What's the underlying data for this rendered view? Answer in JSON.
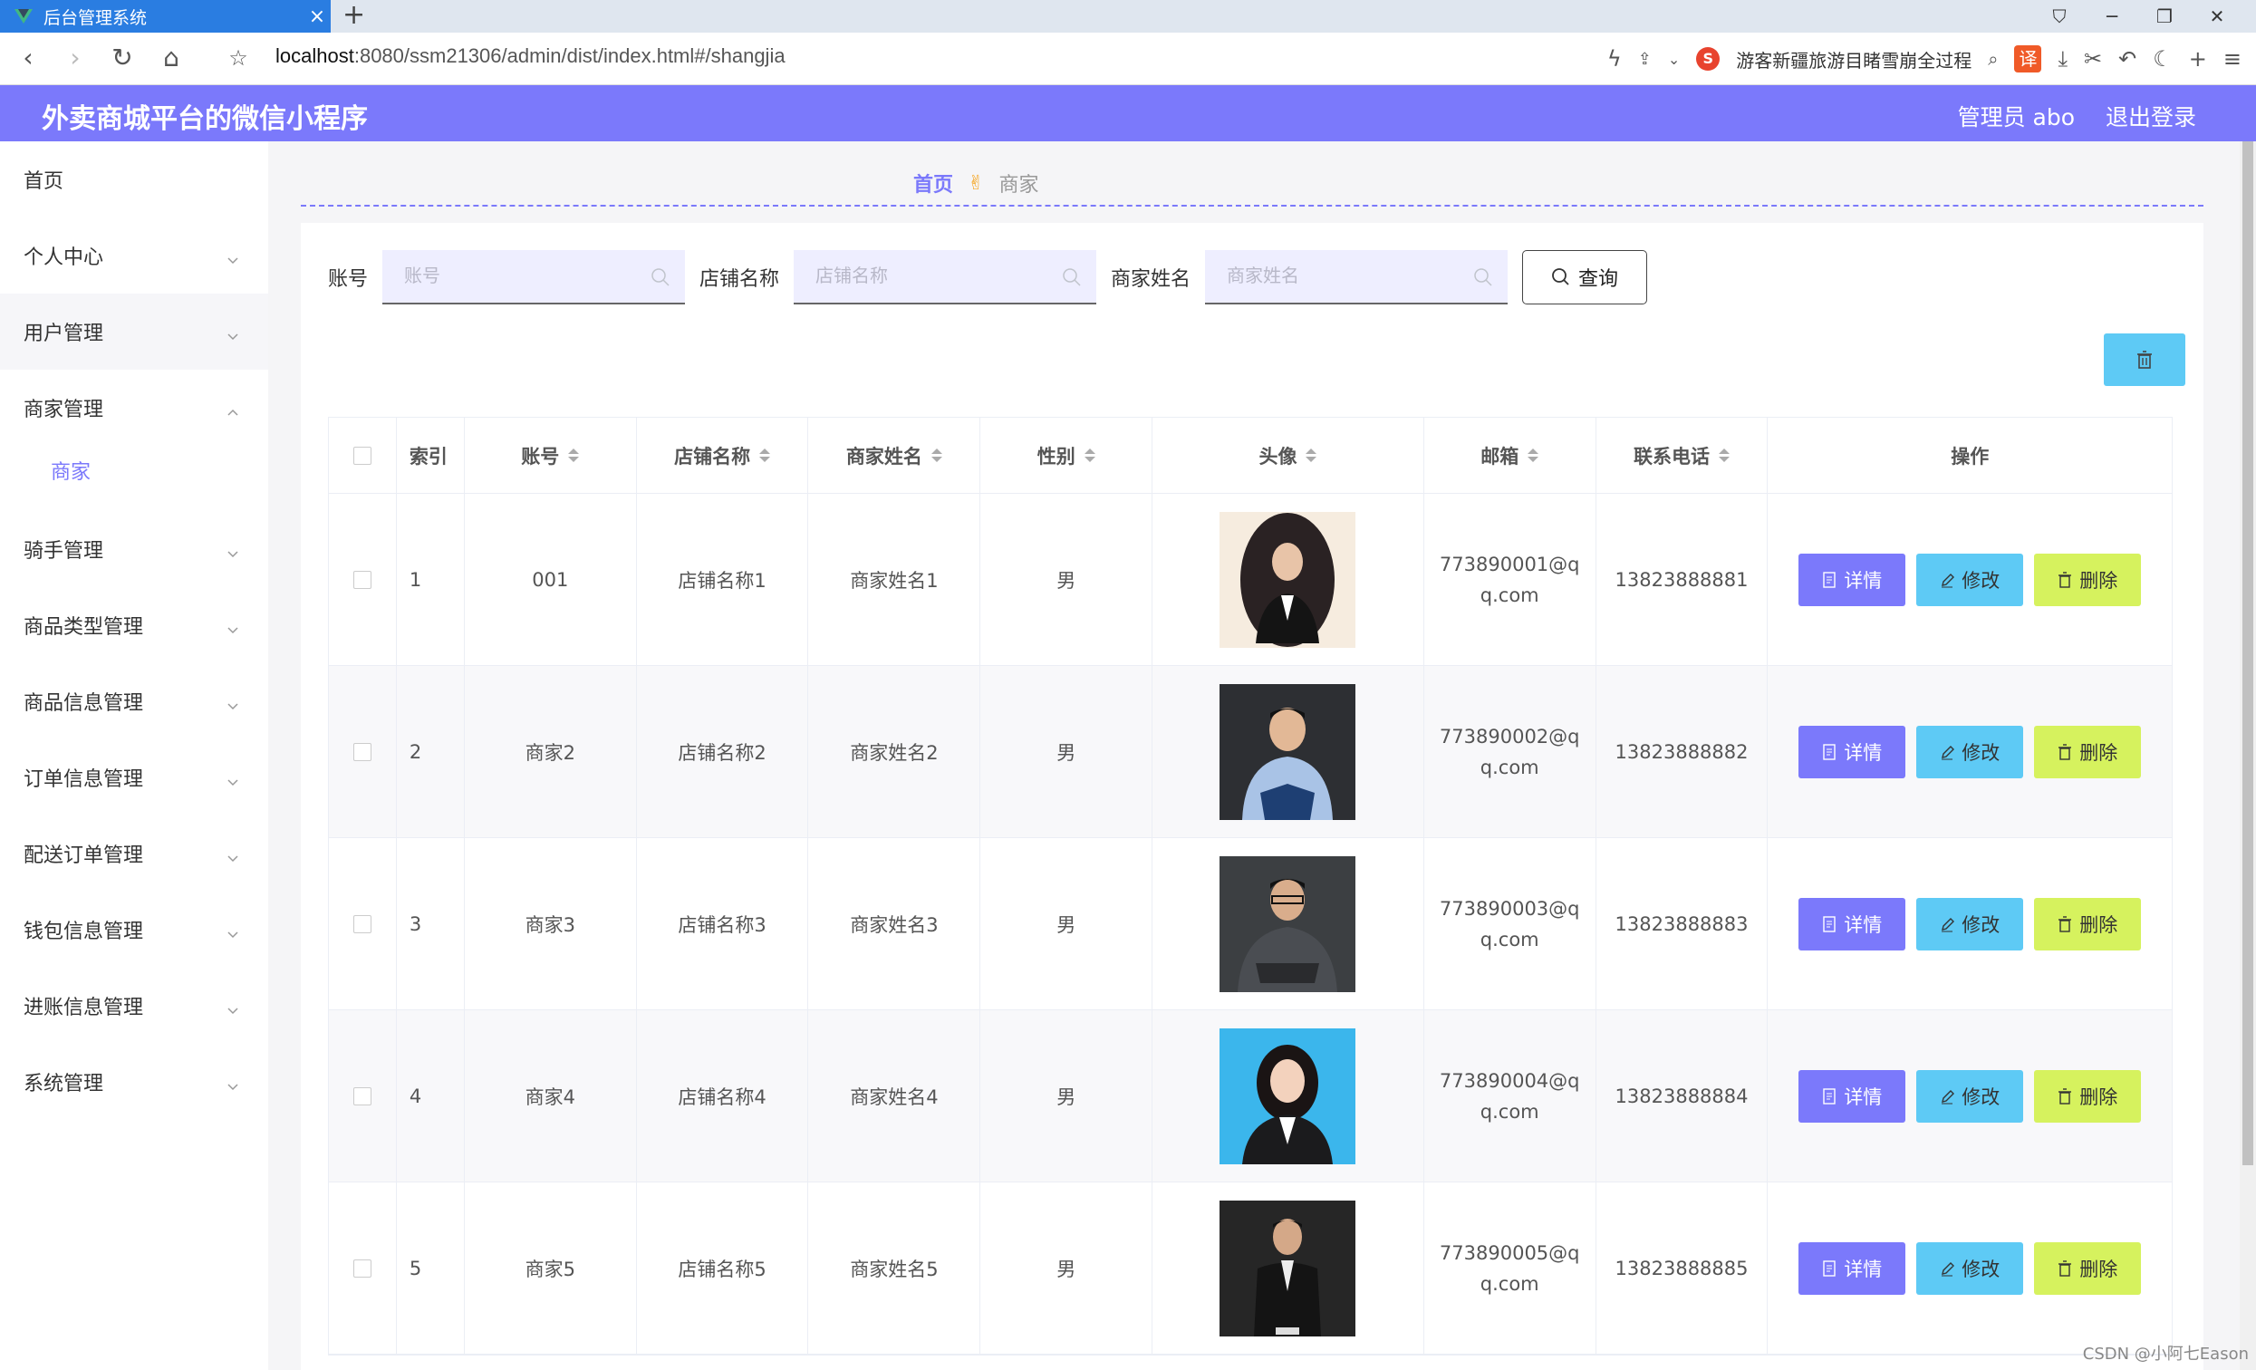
{
  "browser": {
    "tab_title": "后台管理系统",
    "url_host": "localhost",
    "url_rest": ":8080/ssm21306/admin/dist/index.html#/shangjia",
    "news_text": "游客新疆旅游目睹雪崩全过程",
    "translate_label": "译"
  },
  "header": {
    "title": "外卖商城平台的微信小程序",
    "admin": "管理员 abo",
    "logout": "退出登录"
  },
  "sidebar": {
    "items": [
      {
        "label": "首页"
      },
      {
        "label": "个人中心"
      },
      {
        "label": "用户管理"
      },
      {
        "label": "商家管理"
      },
      {
        "label": "骑手管理"
      },
      {
        "label": "商品类型管理"
      },
      {
        "label": "商品信息管理"
      },
      {
        "label": "订单信息管理"
      },
      {
        "label": "配送订单管理"
      },
      {
        "label": "钱包信息管理"
      },
      {
        "label": "进账信息管理"
      },
      {
        "label": "系统管理"
      }
    ],
    "sub_item": "商家"
  },
  "breadcrumb": {
    "home": "首页",
    "sep": "✌",
    "current": "商家"
  },
  "search": {
    "account_label": "账号",
    "account_placeholder": "账号",
    "shop_label": "店铺名称",
    "shop_placeholder": "店铺名称",
    "name_label": "商家姓名",
    "name_placeholder": "商家姓名",
    "query_label": "查询"
  },
  "table": {
    "headers": {
      "index": "索引",
      "account": "账号",
      "shop": "店铺名称",
      "name": "商家姓名",
      "sex": "性别",
      "avatar": "头像",
      "email": "邮箱",
      "phone": "联系电话",
      "ops": "操作"
    },
    "buttons": {
      "detail": "详情",
      "edit": "修改",
      "delete": "删除"
    },
    "rows": [
      {
        "index": "1",
        "account": "001",
        "shop": "店铺名称1",
        "name": "商家姓名1",
        "sex": "男",
        "email": "773890001@qq.com",
        "phone": "13823888881"
      },
      {
        "index": "2",
        "account": "商家2",
        "shop": "店铺名称2",
        "name": "商家姓名2",
        "sex": "男",
        "email": "773890002@qq.com",
        "phone": "13823888882"
      },
      {
        "index": "3",
        "account": "商家3",
        "shop": "店铺名称3",
        "name": "商家姓名3",
        "sex": "男",
        "email": "773890003@qq.com",
        "phone": "13823888883"
      },
      {
        "index": "4",
        "account": "商家4",
        "shop": "店铺名称4",
        "name": "商家姓名4",
        "sex": "男",
        "email": "773890004@qq.com",
        "phone": "13823888884"
      },
      {
        "index": "5",
        "account": "商家5",
        "shop": "店铺名称5",
        "name": "商家姓名5",
        "sex": "男",
        "email": "773890005@qq.com",
        "phone": "13823888885"
      }
    ]
  },
  "watermark": "CSDN @小阿七Eason",
  "colors": {
    "accent": "#7b79fb",
    "edit": "#5ecaf5",
    "delete": "#d6f25e"
  }
}
